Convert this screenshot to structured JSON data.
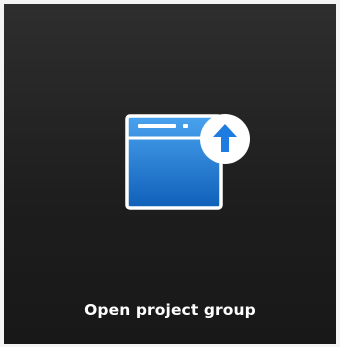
{
  "tile": {
    "label": "Open project group",
    "icon": "window-upload-icon",
    "badge_icon": "arrow-up-icon",
    "colors": {
      "background_top": "#2e2e2e",
      "background_bottom": "#181818",
      "window_blue_top": "#4aa3ef",
      "window_blue_bottom": "#0f5fb8",
      "badge": "#ffffff",
      "arrow": "#1e7ce0",
      "text": "#ffffff"
    }
  }
}
